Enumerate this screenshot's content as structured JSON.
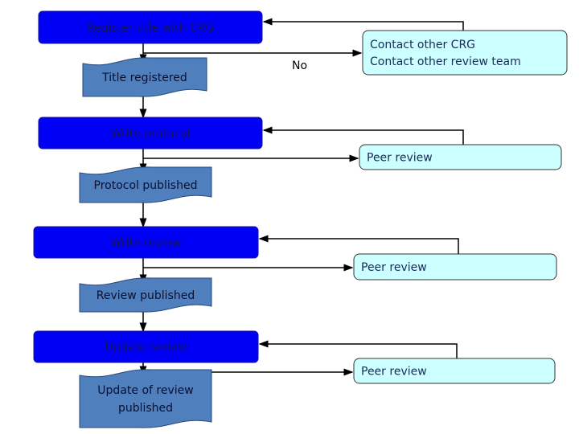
{
  "steps": [
    {
      "process": "Register title with CRG",
      "output": [
        "Title registered"
      ],
      "note": [
        "Contact other CRG",
        "Contact other review team"
      ],
      "branch_label": "No"
    },
    {
      "process": "Write protocol",
      "output": [
        "Protocol published"
      ],
      "note": [
        "Peer review"
      ]
    },
    {
      "process": "Write review",
      "output": [
        "Review published"
      ],
      "note": [
        "Peer review"
      ]
    },
    {
      "process": "Update review",
      "output": [
        "Update of review",
        "published"
      ],
      "note": [
        "Peer review"
      ]
    }
  ],
  "colors": {
    "process": "#0000f5",
    "document": "#4f7fbd",
    "note": "#ccffff"
  }
}
